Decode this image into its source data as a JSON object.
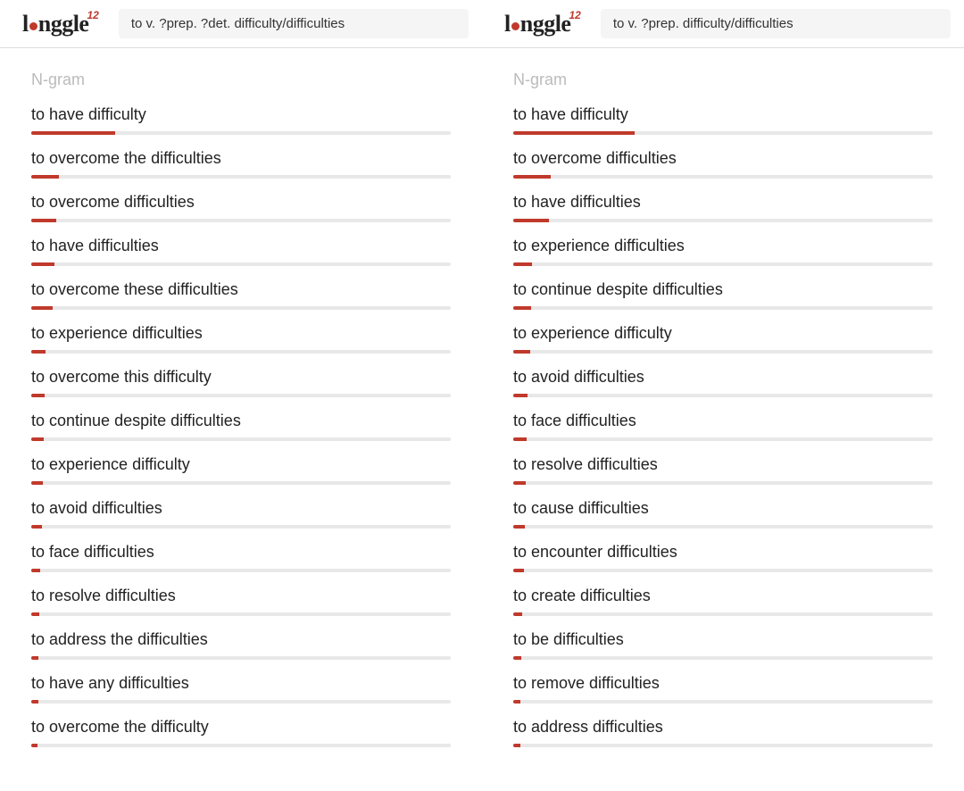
{
  "logo": {
    "text_left": "l",
    "text_mid": "nggle",
    "sup": "12"
  },
  "left": {
    "query": "to v. ?prep. ?det. difficulty/difficulties",
    "section_label": "N-gram",
    "items": [
      {
        "text": "to have difficulty",
        "pct": 20
      },
      {
        "text": "to overcome the difficulties",
        "pct": 6.5
      },
      {
        "text": "to overcome difficulties",
        "pct": 6
      },
      {
        "text": "to have difficulties",
        "pct": 5.5
      },
      {
        "text": "to overcome these difficulties",
        "pct": 5
      },
      {
        "text": "to experience difficulties",
        "pct": 3.5
      },
      {
        "text": "to overcome this difficulty",
        "pct": 3.2
      },
      {
        "text": "to continue despite difficulties",
        "pct": 3
      },
      {
        "text": "to experience difficulty",
        "pct": 2.8
      },
      {
        "text": "to avoid difficulties",
        "pct": 2.5
      },
      {
        "text": "to face difficulties",
        "pct": 2.2
      },
      {
        "text": "to resolve difficulties",
        "pct": 2
      },
      {
        "text": "to address the difficulties",
        "pct": 1.8
      },
      {
        "text": "to have any difficulties",
        "pct": 1.6
      },
      {
        "text": "to overcome the difficulty",
        "pct": 1.5
      }
    ]
  },
  "right": {
    "query": "to v. ?prep. difficulty/difficulties",
    "section_label": "N-gram",
    "items": [
      {
        "text": "to have difficulty",
        "pct": 29
      },
      {
        "text": "to overcome difficulties",
        "pct": 9
      },
      {
        "text": "to have difficulties",
        "pct": 8.5
      },
      {
        "text": "to experience difficulties",
        "pct": 4.5
      },
      {
        "text": "to continue despite difficulties",
        "pct": 4.2
      },
      {
        "text": "to experience difficulty",
        "pct": 4
      },
      {
        "text": "to avoid difficulties",
        "pct": 3.5
      },
      {
        "text": "to face difficulties",
        "pct": 3.2
      },
      {
        "text": "to resolve difficulties",
        "pct": 3
      },
      {
        "text": "to cause difficulties",
        "pct": 2.8
      },
      {
        "text": "to encounter difficulties",
        "pct": 2.5
      },
      {
        "text": "to create difficulties",
        "pct": 2.2
      },
      {
        "text": "to be difficulties",
        "pct": 2
      },
      {
        "text": "to remove difficulties",
        "pct": 1.8
      },
      {
        "text": "to address difficulties",
        "pct": 1.6
      }
    ]
  }
}
